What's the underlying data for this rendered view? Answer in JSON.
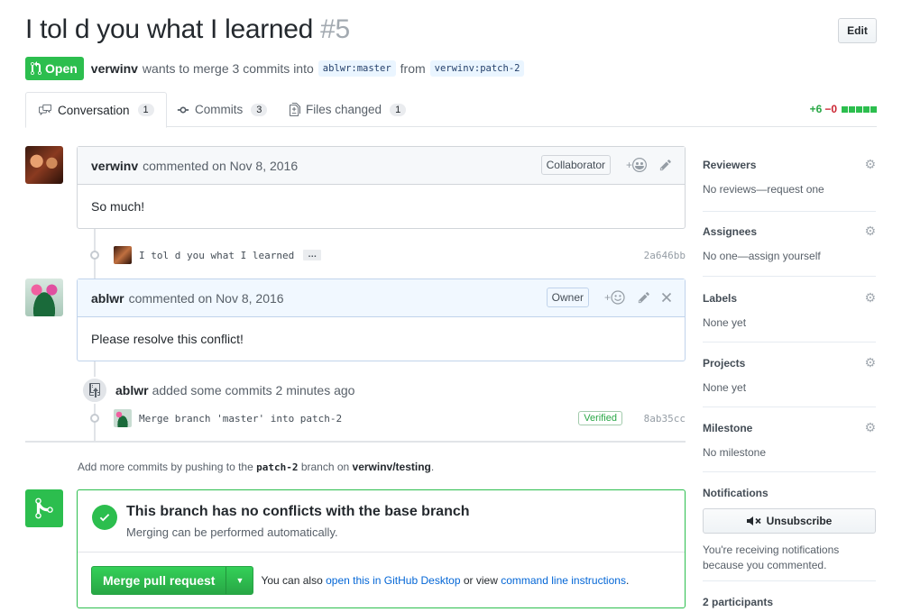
{
  "header": {
    "title": "I tol d you what I learned",
    "number": "#5",
    "edit_label": "Edit",
    "state_label": "Open",
    "author": "verwinv",
    "merge_text": "wants to merge 3 commits into",
    "base_branch": "ablwr:master",
    "from_text": "from",
    "head_branch": "verwinv:patch-2"
  },
  "tabs": [
    {
      "label": "Conversation",
      "count": "1",
      "icon": "comment-discussion-icon"
    },
    {
      "label": "Commits",
      "count": "3",
      "icon": "git-commit-icon"
    },
    {
      "label": "Files changed",
      "count": "1",
      "icon": "file-diff-icon"
    }
  ],
  "diffstat": {
    "additions": "+6",
    "deletions": "−0"
  },
  "timeline": {
    "comment1": {
      "author": "verwinv",
      "action": "commented on Nov 8, 2016",
      "role": "Collaborator",
      "body": "So much!"
    },
    "commit1": {
      "message": "I tol d you what I learned",
      "ellipsis": "…",
      "sha": "2a646bb"
    },
    "comment2": {
      "author": "ablwr",
      "action": "commented on Nov 8, 2016",
      "role": "Owner",
      "body": "Please resolve this conflict!"
    },
    "event": {
      "actor": "ablwr",
      "text": "added some commits 2 minutes ago"
    },
    "commit2": {
      "message": "Merge branch 'master' into patch-2",
      "verified": "Verified",
      "sha": "8ab35cc"
    }
  },
  "hint": {
    "prefix": "Add more commits by pushing to the",
    "branch": "patch-2",
    "middle": "branch on",
    "repo": "verwinv/testing",
    "suffix": "."
  },
  "merge": {
    "title": "This branch has no conflicts with the base branch",
    "subtitle": "Merging can be performed automatically.",
    "button_label": "Merge pull request",
    "alt_prefix": "You can also",
    "desktop_link": "open this in GitHub Desktop",
    "alt_middle": "or view",
    "cli_link": "command line instructions",
    "alt_suffix": "."
  },
  "sidebar": {
    "reviewers": {
      "label": "Reviewers",
      "value": "No reviews—request one"
    },
    "assignees": {
      "label": "Assignees",
      "value": "No one—assign yourself"
    },
    "labels": {
      "label": "Labels",
      "value": "None yet"
    },
    "projects": {
      "label": "Projects",
      "value": "None yet"
    },
    "milestone": {
      "label": "Milestone",
      "value": "No milestone"
    },
    "notifications": {
      "label": "Notifications",
      "button": "Unsubscribe",
      "note": "You're receiving notifications because you commented."
    },
    "participants": "2 participants"
  },
  "colors": {
    "accent_green": "#2cbe4e",
    "link_blue": "#0366d6",
    "deletion_red": "#cb2431"
  }
}
